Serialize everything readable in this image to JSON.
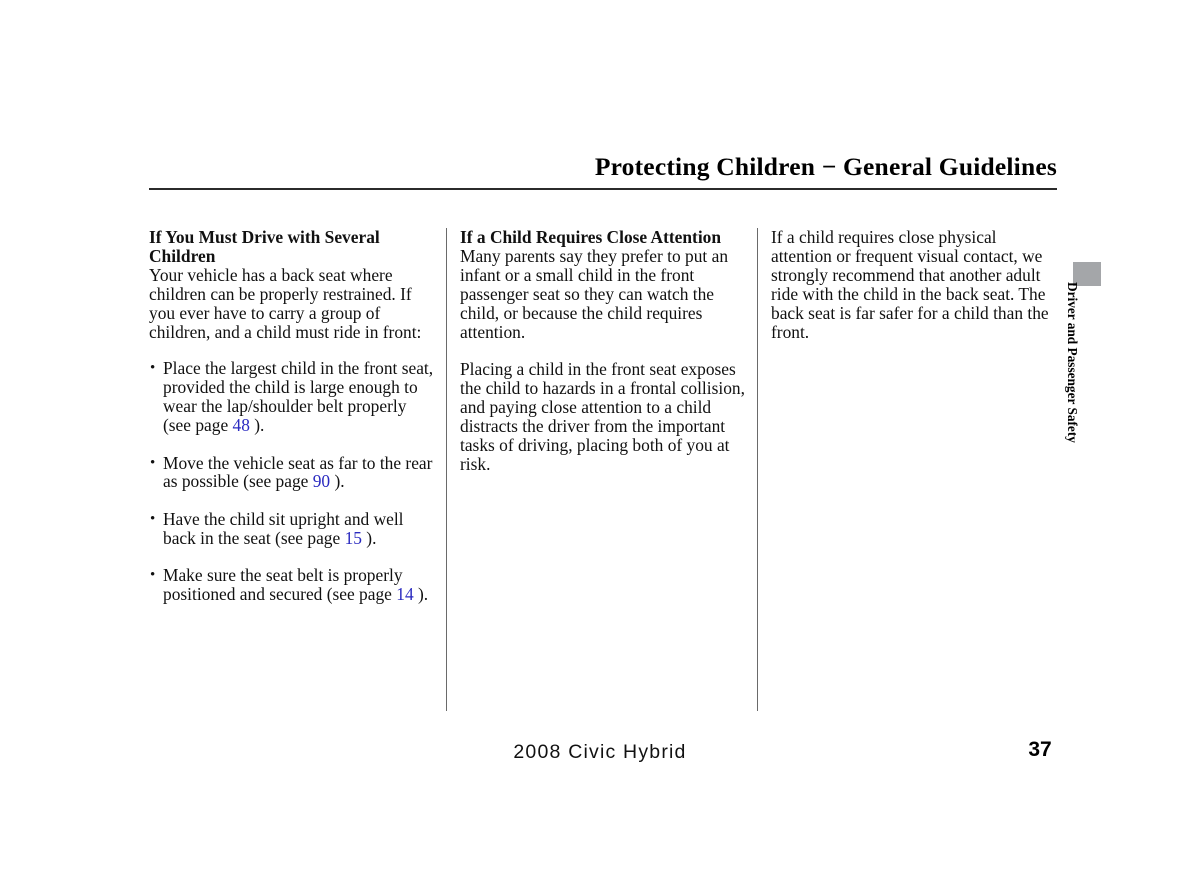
{
  "document": {
    "header_title": "Protecting Children  −  General Guidelines",
    "footer_model": "2008  Civic  Hybrid",
    "page_number": "37",
    "side_tab_label": "Driver and Passenger Safety",
    "accent_color": "#2a2ac0",
    "side_tab_color": "#a4a6a9"
  },
  "columns": {
    "column_1": {
      "heading": "If You Must Drive with Several Children",
      "intro": "Your vehicle has a back seat where children can be properly restrained. If you ever have to carry a group of children, and a child must ride in front:",
      "bullets": [
        {
          "text_before": "Place the largest child in the front seat, provided the child is large enough to wear the lap/shoulder belt properly (see page ",
          "page_ref": "48",
          "text_after": " )."
        },
        {
          "text_before": "Move the vehicle seat as far to the rear as possible (see page ",
          "page_ref": "90",
          "text_after": " )."
        },
        {
          "text_before": "Have the child sit upright and well back in the seat (see page ",
          "page_ref": "15",
          "text_after": " )."
        },
        {
          "text_before": "Make sure the seat belt is properly positioned and secured (see page ",
          "page_ref": "14",
          "text_after": " )."
        }
      ]
    },
    "column_2": {
      "heading": "If a Child Requires Close Attention",
      "paragraph_1": "Many parents say they prefer to put an infant or a small child in the front passenger seat so they can watch the child, or because the child requires attention.",
      "paragraph_2": "Placing a child in the front seat exposes the child to hazards in a frontal collision, and paying close attention to a child distracts the driver from the important tasks of driving, placing both of you at risk."
    },
    "column_3": {
      "paragraph_1": "If a child requires close physical attention or frequent visual contact, we strongly recommend that another adult ride with the child in the back seat. The back seat is far safer for a child than the front."
    }
  }
}
